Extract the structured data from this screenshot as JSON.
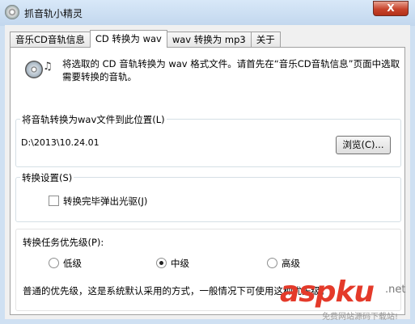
{
  "window": {
    "title": "抓音轨小精灵",
    "close_label": "X"
  },
  "tabs": [
    {
      "label": "音乐CD音轨信息"
    },
    {
      "label": "CD 转换为 wav"
    },
    {
      "label": "wav 转换为 mp3"
    },
    {
      "label": "关于"
    }
  ],
  "intro": {
    "text": "将选取的 CD 音轨转换为 wav 格式文件。请首先在“音乐CD音轨信息”页面中选取需要转换的音轨。"
  },
  "output_group": {
    "label": "将音轨转换为wav文件到此位置(L)",
    "path": "D:\\2013\\10.24.01",
    "browse_label": "浏览(C)..."
  },
  "settings_group": {
    "label": "转换设置(S)",
    "eject_label": "转换完毕弹出光驱(J)",
    "eject_checked": false
  },
  "priority_group": {
    "label": "转换任务优先级(P):",
    "options": [
      {
        "label": "低级",
        "selected": false
      },
      {
        "label": "中级",
        "selected": true
      },
      {
        "label": "高级",
        "selected": false
      }
    ],
    "note": "普通的优先级，这是系统默认采用的方式，一般情况下可使用这种优先级。"
  },
  "watermark": {
    "logo": "aspku",
    "domain": ".net",
    "tagline": "免费网站源码下载站!"
  }
}
